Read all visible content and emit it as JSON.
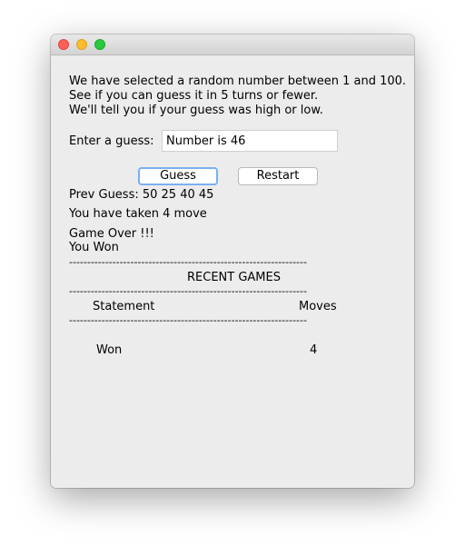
{
  "window": {
    "title": ""
  },
  "intro": {
    "line1": "We have selected a random number between 1 and 100.",
    "line2": "See if you can guess it in 5 turns or fewer.",
    "line3": "We'll tell you if your guess was high or low."
  },
  "guess_form": {
    "label": "Enter a guess:",
    "input_value": "Number is 46"
  },
  "buttons": {
    "guess_label": "Guess",
    "restart_label": "Restart"
  },
  "status": {
    "prev_guess": "Prev Guess: 50 25 40 45",
    "moves_taken": "You have taken 4 move",
    "game_over": "Game Over !!!",
    "result": "You Won"
  },
  "recent_games": {
    "title": "RECENT GAMES",
    "separator": "------------------------------------------------------------------",
    "columns": [
      "Statement",
      "Moves"
    ],
    "rows": [
      {
        "statement": "Won",
        "moves": "4"
      }
    ]
  }
}
